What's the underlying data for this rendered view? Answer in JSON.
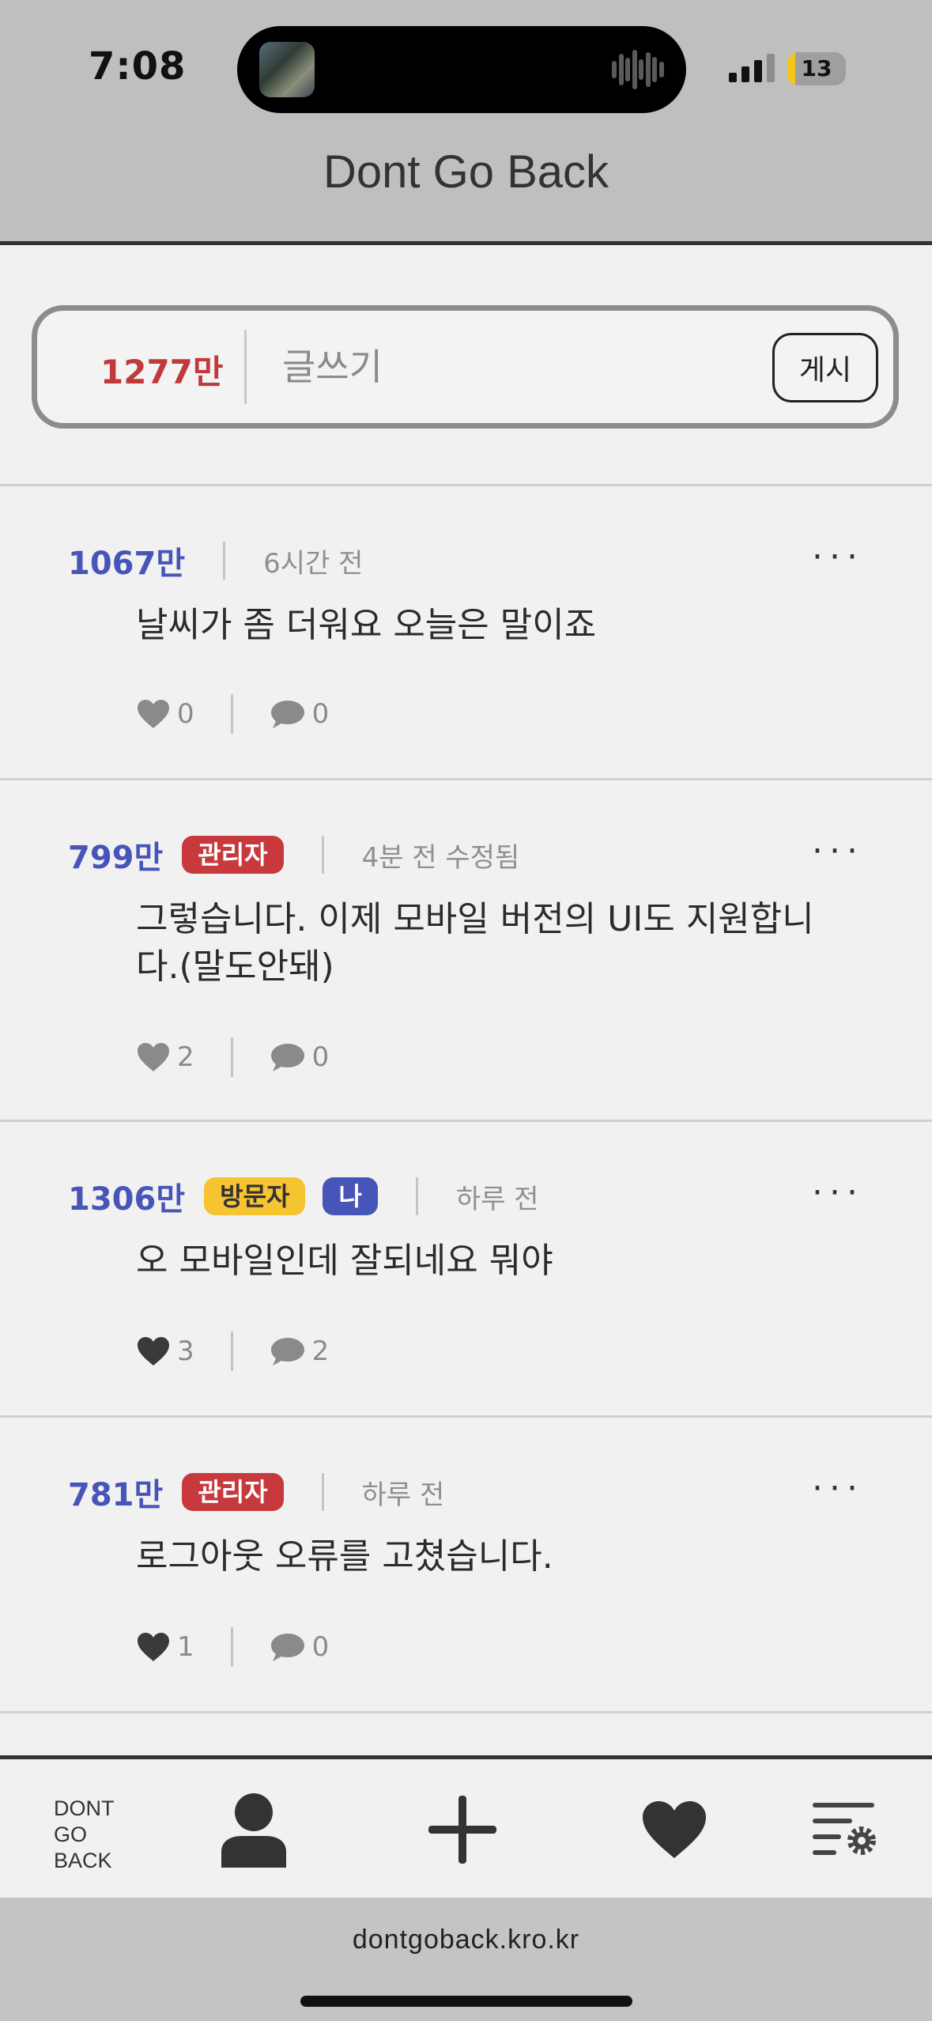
{
  "status": {
    "time": "7:08",
    "battery": "13",
    "battery_level": 0.13
  },
  "header": {
    "title": "Dont Go Back"
  },
  "compose": {
    "points": "1277만",
    "placeholder": "글쓰기",
    "post_label": "게시"
  },
  "posts": [
    {
      "points": "1067만",
      "time": "6시간 전",
      "body": "날씨가 좀 더워요 오늘은 말이죠",
      "likes": "0",
      "comments": "0",
      "more": "···"
    },
    {
      "points": "799만",
      "badge": "관리자",
      "time": "4분 전 수정됨",
      "body": "그렇습니다. 이제 모바일 버전의 UI도 지원합니다.(말도안돼)",
      "likes": "2",
      "comments": "0",
      "more": "···"
    },
    {
      "points": "1306만",
      "badge": "방문자",
      "badge_me": "나",
      "time": "하루 전",
      "body": "오 모바일인데 잘되네요 뭐야",
      "likes": "3",
      "comments": "2",
      "more": "···",
      "liked": true
    },
    {
      "points": "781만",
      "badge": "관리자",
      "time": "하루 전",
      "body": "로그아웃 오류를 고쳤습니다.",
      "likes": "1",
      "comments": "0",
      "more": "···",
      "liked": true
    }
  ],
  "nav": {
    "logo_line1": "DONT",
    "logo_line2": "GO",
    "logo_line3": "BACK",
    "items": [
      "profile-icon",
      "add-icon",
      "heart-icon",
      "settings-icon"
    ]
  },
  "browser": {
    "url": "dontgoback.kro.kr"
  },
  "colors": {
    "points_blue": "#4755b8",
    "points_red": "#c0393b",
    "admin_badge": "#c7393c",
    "visitor_badge": "#f6c430"
  }
}
